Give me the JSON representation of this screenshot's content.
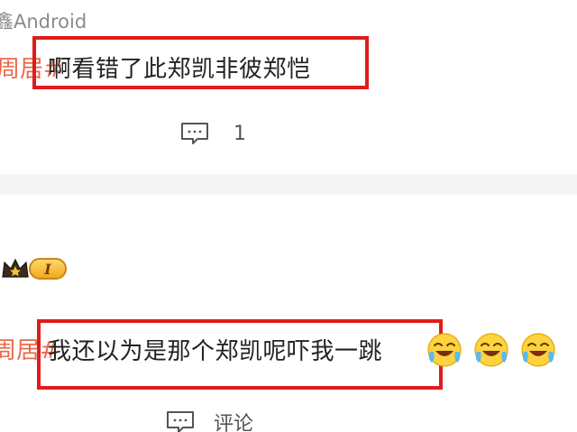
{
  "post_top": {
    "source": "鑫Android",
    "topic_tail": "周居#",
    "text": "啊看错了此郑凯非彼郑恺",
    "reply_count": "1"
  },
  "post_bottom": {
    "level_badge": "I",
    "topic_tail": "周居#",
    "text": "我还以为是那个郑凯呢吓我一跳",
    "comment_label": "评论"
  },
  "colors": {
    "highlight": "#e01b1b",
    "topic_link": "#e86a4c",
    "badge_gold": "#f2a81d"
  },
  "icons": [
    "comment-icon",
    "crown-icon",
    "laughing-crying-emoji"
  ]
}
